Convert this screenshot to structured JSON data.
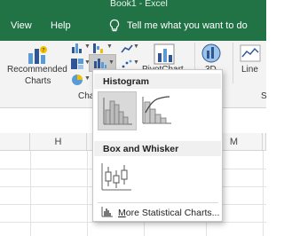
{
  "window": {
    "title": "Book1  -  Excel"
  },
  "tabs": [
    {
      "label": "View"
    },
    {
      "label": "Help"
    }
  ],
  "tell_me": {
    "text": "Tell me what you want to do"
  },
  "ribbon": {
    "recommended_charts": {
      "line1": "Recommended",
      "line2": "Charts"
    },
    "group_label_partial": "Cha",
    "pivotchart_label": "PivotChart",
    "map_3d_label": "3D",
    "line_label": "Line",
    "right_partial": "S"
  },
  "columns": [
    {
      "label": "H"
    },
    {
      "label": "I"
    },
    {
      "label": "M"
    }
  ],
  "dropdown": {
    "histogram": {
      "heading": "Histogram",
      "items": [
        {
          "name": "Histogram"
        },
        {
          "name": "Pareto"
        }
      ]
    },
    "box_whisker": {
      "heading": "Box and Whisker",
      "items": [
        {
          "name": "Box and Whisker"
        }
      ]
    },
    "more_label": "More Statistical Charts..."
  },
  "colors": {
    "excel_green": "#217346",
    "ribbon_bg": "#f3f3f3",
    "selected_thumb": "#d9d9d9"
  }
}
